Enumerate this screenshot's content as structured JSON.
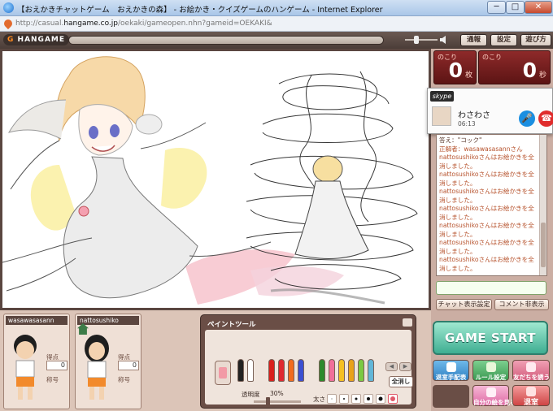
{
  "window": {
    "title": "【おえかきチャットゲーム　おえかきの森】 - お絵かき・クイズゲームのハンゲーム - Internet Explorer",
    "minimize": "─",
    "maximize": "□",
    "close": "✕",
    "url_prefix": "http://casual.",
    "url_domain": "hangame.co.jp",
    "url_suffix": "/oekaki/gameopen.nhn?gameid=OEKAKI&"
  },
  "gamebar": {
    "logo_g": "G",
    "logo_text": "HANGAME",
    "buttons": [
      "通報",
      "設定",
      "遊び方"
    ]
  },
  "counters": {
    "remaining_label": "のこり",
    "remaining_value": "0",
    "remaining_unit": "枚",
    "time_label": "のこり",
    "time_value": "0",
    "time_unit": "秒"
  },
  "skype": {
    "logo": "skype",
    "caller_name": "わさわさ",
    "call_time": "06:13",
    "mic_icon": "🎤",
    "hangup_icon": "☎"
  },
  "chat": {
    "lines": [
      {
        "text": "答え：\"コック\"",
        "tone": "dark"
      },
      {
        "text": "正解者：wasawasasannさん",
        "tone": "accent"
      },
      {
        "text": "nattosushikoさんはお絵かきを全",
        "tone": "accent"
      },
      {
        "text": "消しました。",
        "tone": "accent"
      },
      {
        "text": "nattosushikoさんはお絵かきを全",
        "tone": "accent"
      },
      {
        "text": "消しました。",
        "tone": "accent"
      },
      {
        "text": "nattosushikoさんはお絵かきを全",
        "tone": "accent"
      },
      {
        "text": "消しました。",
        "tone": "accent"
      },
      {
        "text": "nattosushikoさんはお絵かきを全",
        "tone": "accent"
      },
      {
        "text": "消しました。",
        "tone": "accent"
      },
      {
        "text": "nattosushikoさんはお絵かきを全",
        "tone": "accent"
      },
      {
        "text": "消しました。",
        "tone": "accent"
      },
      {
        "text": "nattosushikoさんはお絵かきを全",
        "tone": "accent"
      },
      {
        "text": "消しました。",
        "tone": "accent"
      },
      {
        "text": "nattosushikoさんはお絵かきを全",
        "tone": "accent"
      },
      {
        "text": "消しました。",
        "tone": "accent"
      }
    ],
    "input_value": "",
    "btn_display": "チャット表示設定",
    "btn_comment": "コメント非表示"
  },
  "actions": {
    "game_start": "GAME START",
    "kick": "退室手配表",
    "rule": "ルール設定",
    "friend": "友だちを誘う",
    "mypic": "自分の絵を見る",
    "exit": "退室"
  },
  "players": [
    {
      "name": "wasawasasann",
      "score_label": "得点",
      "score": "0",
      "title_label": "称号"
    },
    {
      "name": "nattosushiko",
      "score_label": "得点",
      "score": "0",
      "title_label": "称号"
    }
  ],
  "painttool": {
    "title": "ペイントツール",
    "opacity_label": "透明度",
    "opacity_value": "30%",
    "opacity_level": 0.3,
    "thickness_label": "太さ",
    "clear_label": "全消し",
    "arrow_left": "◀",
    "arrow_right": "▶",
    "pens": [
      "#222222",
      "#ffffff",
      "#d9201c",
      "#e0282f",
      "#f26b1d",
      "#3b4fd1",
      "#2c8a2c",
      "#f06f9a",
      "#f5c021",
      "#e8a21a",
      "#7ac943",
      "#62b6d8"
    ],
    "selected_brush": 5
  },
  "colors": {
    "accent": "#b6512b",
    "counter_bg": "#8e2a2a",
    "game_start": "#3fae92"
  }
}
